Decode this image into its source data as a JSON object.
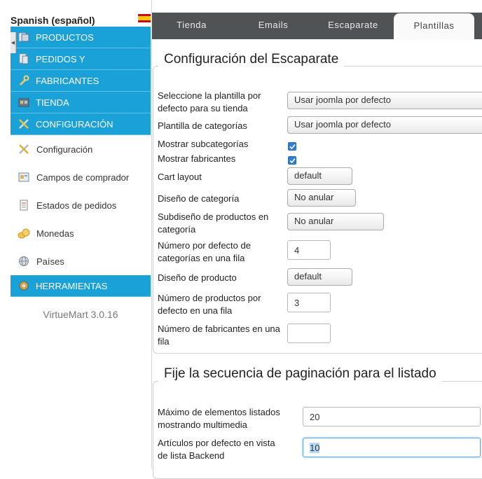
{
  "sidebar": {
    "language": "Spanish (español)",
    "main_items": [
      {
        "label": "PRODUCTOS",
        "icon": "products-icon"
      },
      {
        "label": "PEDIDOS Y",
        "icon": "orders-icon"
      },
      {
        "label": "FABRICANTES",
        "icon": "wrench-icon"
      },
      {
        "label": "TIENDA",
        "icon": "store-icon"
      },
      {
        "label": "CONFIGURACIÓN",
        "icon": "tools-icon"
      }
    ],
    "sub_items": [
      {
        "label": "Configuración",
        "icon": "tools-icon"
      },
      {
        "label": "Campos de comprador",
        "icon": "form-icon"
      },
      {
        "label": "Estados de pedidos",
        "icon": "document-icon"
      },
      {
        "label": "Monedas",
        "icon": "coins-icon"
      },
      {
        "label": "Países",
        "icon": "globe-icon"
      }
    ],
    "tools_item": {
      "label": "HERRAMIENTAS",
      "icon": "toolbox-icon"
    },
    "version": "VirtueMart 3.0.16"
  },
  "tabs": [
    {
      "label": "Tienda",
      "active": false
    },
    {
      "label": "Emails",
      "active": false
    },
    {
      "label": "Escaparate",
      "active": false
    },
    {
      "label": "Plantillas",
      "active": true
    }
  ],
  "storefront": {
    "legend": "Configuración del Escaparate",
    "template_label": "Seleccione la plantilla por defecto para su tienda",
    "template_value": "Usar joomla por defecto",
    "category_template_label": "Plantilla de categorías",
    "category_template_value": "Usar joomla por defecto",
    "show_subcategories_label": "Mostrar subcategorías",
    "show_subcategories_checked": true,
    "show_manufacturers_label": "Mostrar fabricantes",
    "show_manufacturers_checked": true,
    "cart_layout_label": "Cart layout",
    "cart_layout_value": "default",
    "category_layout_label": "Diseño de categoría",
    "category_layout_value": "No anular",
    "product_sublayout_label": "Subdiseño de productos en categoría",
    "product_sublayout_value": "No anular",
    "categories_per_row_label": "Número por defecto de categorías en una fila",
    "categories_per_row_value": "4",
    "product_layout_label": "Diseño de producto",
    "product_layout_value": "default",
    "products_per_row_label": "Número de productos por defecto en una fila",
    "products_per_row_value": "3",
    "manufacturers_per_row_label": "Número de fabricantes en una fila",
    "manufacturers_per_row_value": ""
  },
  "pagination": {
    "legend": "Fije la secuencia de paginación para el listado",
    "max_media_label": "Máximo de elementos listados mostrando multimedia",
    "max_media_value": "20",
    "backend_list_label": "Artículos por defecto en vista de lista Backend",
    "backend_list_value": "10"
  },
  "colors": {
    "menu_blue": "#1aa1d8",
    "tabbar_dark": "#505355",
    "checkbox_blue": "#2f7ed8"
  }
}
